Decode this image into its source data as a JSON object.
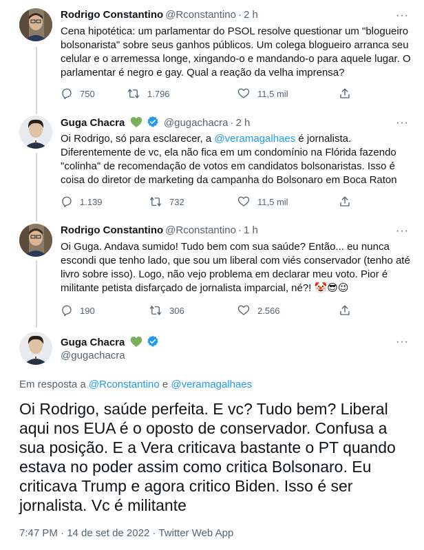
{
  "tweets": [
    {
      "name": "Rodrigo Constantino",
      "handle": "@Rconstantino",
      "time": "2 h",
      "text": "Cena hipotética: um parlamentar do PSOL resolve questionar um \"blogueiro bolsonarista\" sobre seus ganhos públicos. Um colega blogueiro arranca seu celular e o arremessa longe, xingando-o e mandando-o para aquele lugar. O parlamentar é negro e gay. Qual a reação da velha imprensa?",
      "replies": "750",
      "retweets": "1.796",
      "views": "11,5 mil"
    },
    {
      "name": "Guga Chacra",
      "handle": "@gugachacra",
      "time": "2 h",
      "text_before": "Oi Rodrigo, só para esclarecer, a ",
      "mention": "@veramagalhaes",
      "text_after": " é jornalista. Diferentemente de vc, ela não fica em um condomínio na Flórida fazendo \"colinha\" de recomendação de votos em candidatos bolsonaristas. Isso é coisa do diretor de marketing da campanha do Bolsonaro em Boca Raton",
      "replies": "1.139",
      "retweets": "732",
      "views": "11,5 mil"
    },
    {
      "name": "Rodrigo Constantino",
      "handle": "@Rconstantino",
      "time": "1 h",
      "text": "Oi Guga. Andava sumido! Tudo bem com sua saúde? Então... eu nunca escondi que tenho lado, que sou um liberal com viés conservador (tenho até livro sobre isso). Logo, não vejo problema em declarar meu voto. Pior é militante petista disfarçado de jornalista imparcial, né?! 🤡😎😉",
      "replies": "190",
      "retweets": "306",
      "views": "2.566"
    }
  ],
  "main": {
    "name": "Guga Chacra",
    "handle": "@gugachacra",
    "replying_prefix": "Em resposta a ",
    "replying_user1": "@Rconstantino",
    "replying_and": " e ",
    "replying_user2": "@veramagalhaes",
    "text": "Oi Rodrigo, saúde perfeita. E vc? Tudo bem? Liberal aqui nos EUA é o oposto de conservador. Confusa a sua posição. E a Vera criticava bastante o PT quando estava no poder assim como critica Bolsonaro. Eu criticava Trump e agora critico Biden. Isso é ser jornalista. Vc é militante",
    "meta": "7:47 PM · 14 de set de 2022 · Twitter Web App"
  },
  "dot_sep": "·",
  "more_glyph": "···",
  "colors": {
    "link": "#1d9bf0",
    "secondary": "#536471",
    "verified": "#1d9bf0",
    "heart": "#78b159"
  }
}
